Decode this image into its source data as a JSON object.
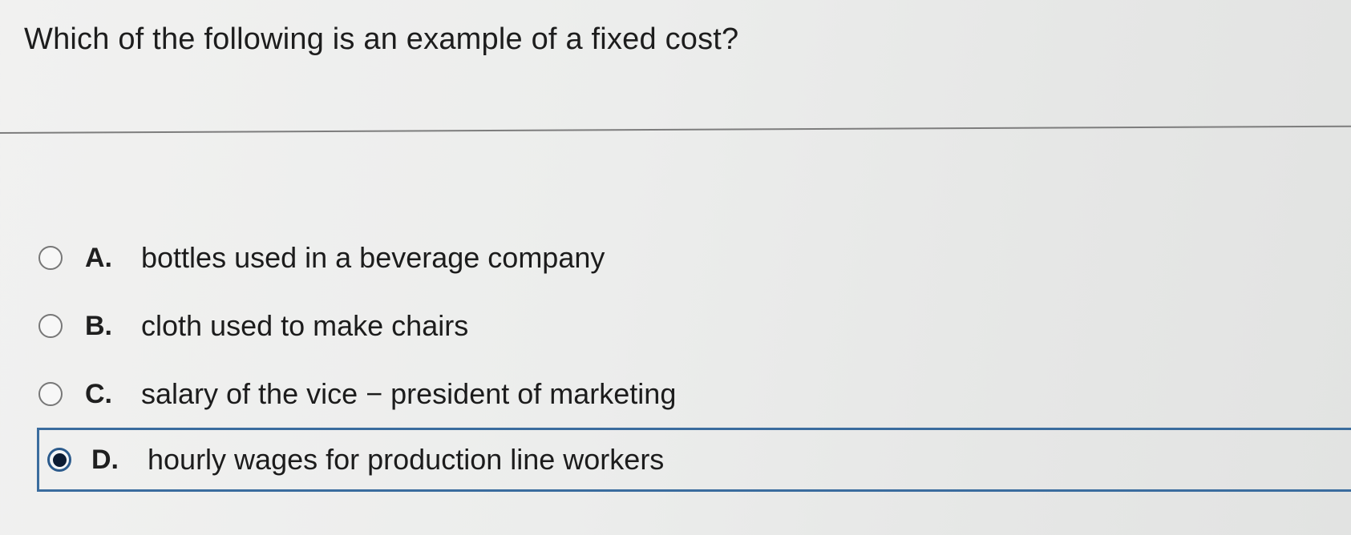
{
  "question": {
    "text": "Which of the following is an example of a fixed cost?"
  },
  "options": [
    {
      "letter": "A.",
      "text": "bottles used in a beverage company",
      "selected": false
    },
    {
      "letter": "B.",
      "text": "cloth used to make chairs",
      "selected": false
    },
    {
      "letter": "C.",
      "text": "salary of the vice − president of marketing",
      "selected": false
    },
    {
      "letter": "D.",
      "text": "hourly wages for production line workers",
      "selected": true
    }
  ],
  "colors": {
    "selected_border": "#3a6c9e",
    "radio_dot": "#0c1c33"
  }
}
